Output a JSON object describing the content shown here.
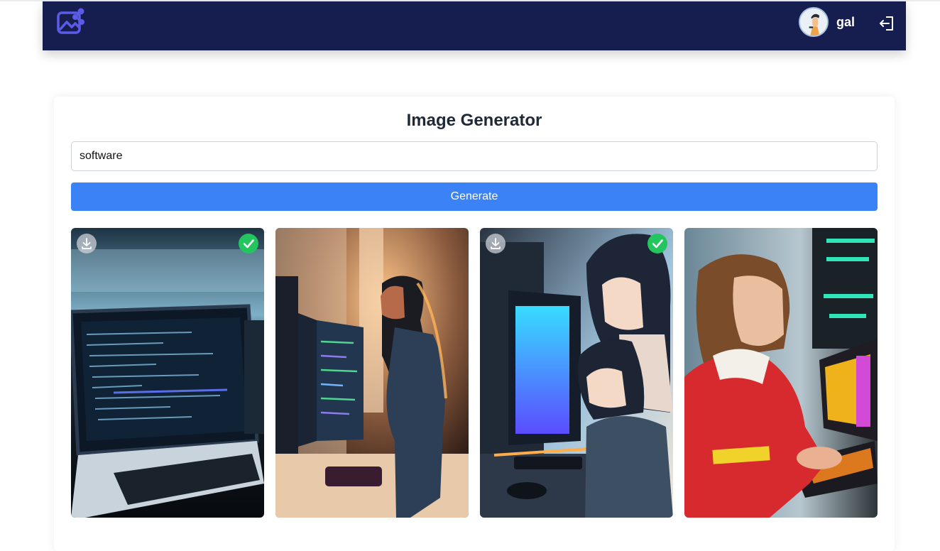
{
  "header": {
    "logo_icon": "image-share-icon",
    "username": "gal",
    "avatar_icon": "user-avatar",
    "logout_icon": "logout-icon",
    "brand_color": "#161e4f"
  },
  "generator": {
    "title": "Image Generator",
    "prompt_value": "software",
    "prompt_placeholder": "",
    "button_label": "Generate",
    "accent_color": "#3b82f6"
  },
  "images": [
    {
      "subject": "laptop-with-code",
      "selected": true,
      "download_icon": "download-icon"
    },
    {
      "subject": "girl-at-monitor",
      "selected": false,
      "download_icon": "download-icon"
    },
    {
      "subject": "anime-girls-at-computer",
      "selected": true,
      "download_icon": "download-icon"
    },
    {
      "subject": "girl-coding-keyboard",
      "selected": false,
      "download_icon": "download-icon"
    }
  ]
}
